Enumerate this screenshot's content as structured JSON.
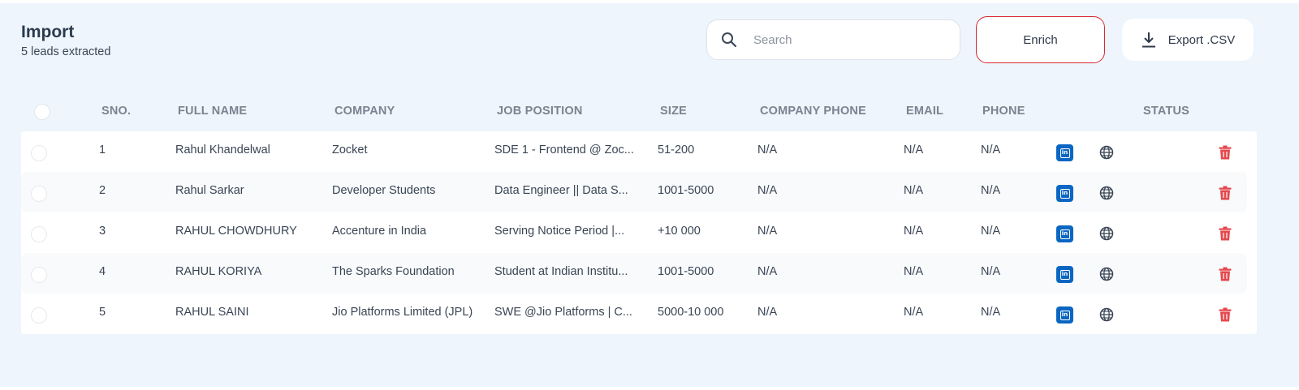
{
  "header": {
    "title": "Import",
    "subtitle": "5 leads extracted"
  },
  "search": {
    "placeholder": "Search",
    "value": ""
  },
  "toolbar": {
    "enrich_label": "Enrich",
    "export_label": "Export .CSV"
  },
  "colors": {
    "accent_border": "#d6282f",
    "linkedin": "#0a66c2",
    "delete": "#e5484d",
    "background": "#eef5fc"
  },
  "table": {
    "columns": [
      "SNO.",
      "FULL NAME",
      "COMPANY",
      "JOB POSITION",
      "SIZE",
      "COMPANY PHONE",
      "EMAIL",
      "PHONE",
      "STATUS"
    ],
    "rows": [
      {
        "sno": "1",
        "name": "Rahul Khandelwal",
        "company": "Zocket",
        "position": "SDE 1 - Frontend @ Zoc...",
        "size": "51-200",
        "company_phone": "N/A",
        "email": "N/A",
        "phone": "N/A"
      },
      {
        "sno": "2",
        "name": "Rahul Sarkar",
        "company": "Developer Students",
        "position": "Data Engineer || Data S...",
        "size": "1001-5000",
        "company_phone": "N/A",
        "email": "N/A",
        "phone": "N/A"
      },
      {
        "sno": "3",
        "name": "RAHUL CHOWDHURY",
        "company": "Accenture in India",
        "position": "Serving Notice Period |...",
        "size": "+10 000",
        "company_phone": "N/A",
        "email": "N/A",
        "phone": "N/A"
      },
      {
        "sno": "4",
        "name": "RAHUL KORIYA",
        "company": "The Sparks Foundation",
        "position": "Student at Indian Institu...",
        "size": "1001-5000",
        "company_phone": "N/A",
        "email": "N/A",
        "phone": "N/A"
      },
      {
        "sno": "5",
        "name": "RAHUL SAINI",
        "company": "Jio Platforms Limited (JPL)",
        "position": "SWE @Jio Platforms | C...",
        "size": "5000-10 000",
        "company_phone": "N/A",
        "email": "N/A",
        "phone": "N/A"
      }
    ]
  },
  "icons": {
    "search": "search-icon",
    "export": "download-icon",
    "linkedin": "linkedin-icon",
    "website": "globe-icon",
    "delete": "trash-icon"
  }
}
